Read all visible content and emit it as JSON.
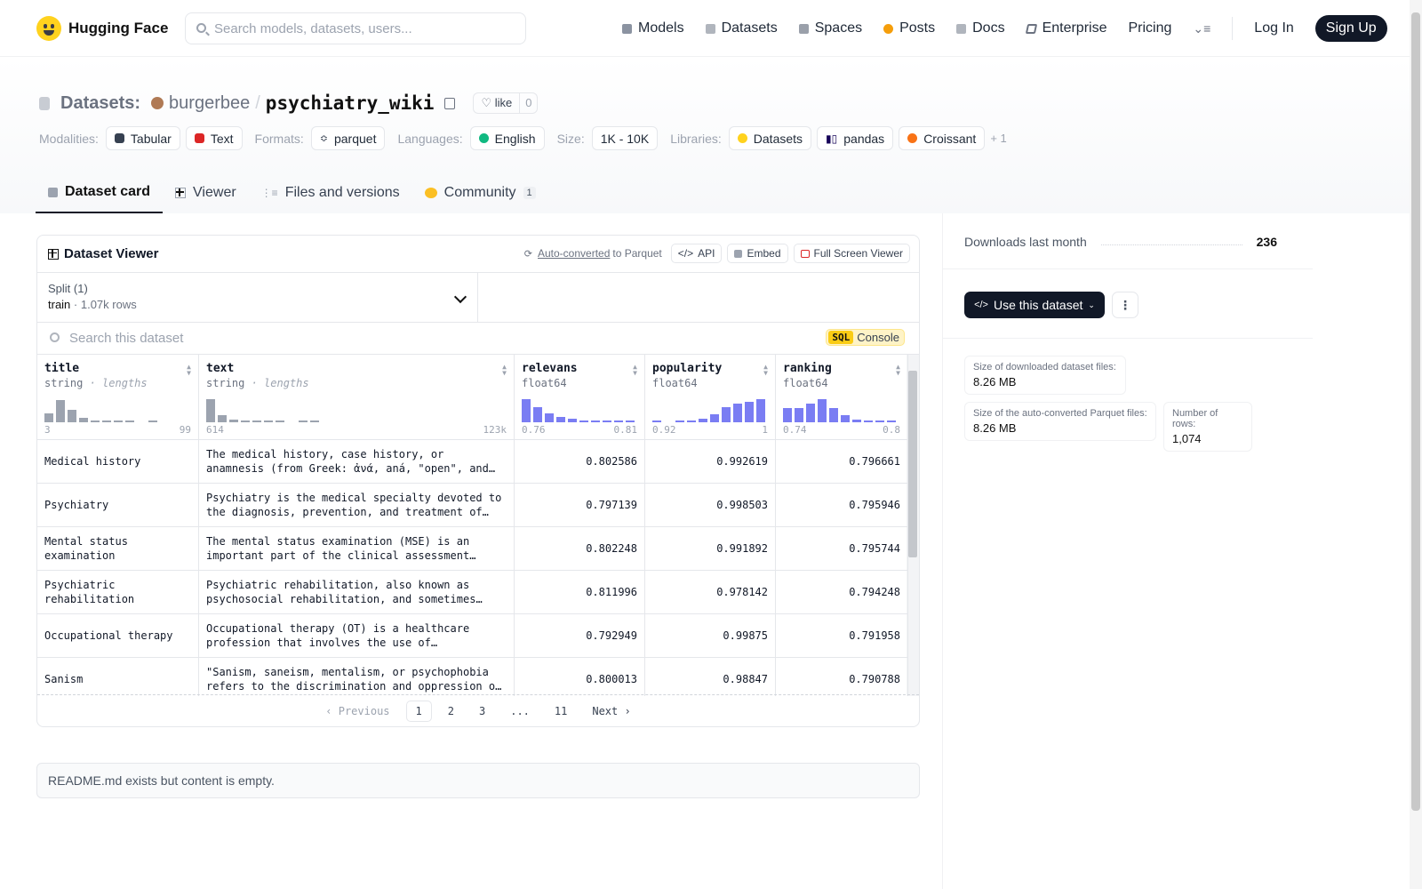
{
  "nav": {
    "brand": "Hugging Face",
    "search_placeholder": "Search models, datasets, users...",
    "links": [
      {
        "label": "Models",
        "icon": "models-icon",
        "color": "#8b93a1"
      },
      {
        "label": "Datasets",
        "icon": "datasets-icon",
        "color": "#b0b5bd"
      },
      {
        "label": "Spaces",
        "icon": "spaces-icon",
        "color": "#9aa0aa"
      },
      {
        "label": "Posts",
        "icon": "posts-icon",
        "color": "#f59e0b"
      },
      {
        "label": "Docs",
        "icon": "docs-icon",
        "color": "#b0b5bd"
      },
      {
        "label": "Enterprise",
        "icon": "enterprise-icon",
        "color": "#6b7280"
      },
      {
        "label": "Pricing",
        "icon": "",
        "color": ""
      }
    ],
    "login": "Log In",
    "signup": "Sign Up"
  },
  "header": {
    "section": "Datasets:",
    "owner": "burgerbee",
    "slash": "/",
    "name": "psychiatry_wiki",
    "like_label": "like",
    "like_count": "0",
    "tags": {
      "modalities_label": "Modalities:",
      "modalities": [
        "Tabular",
        "Text"
      ],
      "formats_label": "Formats:",
      "formats": [
        "parquet"
      ],
      "languages_label": "Languages:",
      "languages": [
        "English"
      ],
      "size_label": "Size:",
      "size": "1K - 10K",
      "libraries_label": "Libraries:",
      "libraries": [
        "Datasets",
        "pandas",
        "Croissant"
      ],
      "more": "+ 1"
    },
    "tabs": [
      {
        "label": "Dataset card",
        "active": true
      },
      {
        "label": "Viewer"
      },
      {
        "label": "Files and versions"
      },
      {
        "label": "Community",
        "badge": "1"
      }
    ]
  },
  "viewer": {
    "title": "Dataset Viewer",
    "auto_converted": "Auto-converted",
    "to_parquet": "to Parquet",
    "api": "API",
    "embed": "Embed",
    "full_screen": "Full Screen Viewer",
    "split_label": "Split (1)",
    "split_name": "train",
    "split_rows": "· 1.07k rows",
    "search_placeholder": "Search this dataset",
    "sql": "SQL",
    "console": "Console",
    "columns": [
      {
        "name": "title",
        "type": "string",
        "sub": "· lengths",
        "min": "3",
        "max": "99",
        "hist": [
          0.4,
          0.95,
          0.55,
          0.2,
          0.08,
          0.05,
          0.04,
          0.04,
          0,
          0.03
        ],
        "kind": "str"
      },
      {
        "name": "text",
        "type": "string",
        "sub": "· lengths",
        "min": "614",
        "max": "123k",
        "hist": [
          1,
          0.3,
          0.12,
          0.06,
          0.04,
          0.03,
          0.03,
          0,
          0.02,
          0.02
        ],
        "kind": "str"
      },
      {
        "name": "relevans",
        "type": "float64",
        "sub": "",
        "min": "0.76",
        "max": "0.81",
        "hist": [
          1,
          0.65,
          0.4,
          0.22,
          0.15,
          0.08,
          0.05,
          0.03,
          0.03,
          0.03
        ],
        "kind": "num"
      },
      {
        "name": "popularity",
        "type": "float64",
        "sub": "",
        "min": "0.92",
        "max": "1",
        "hist": [
          0.03,
          0,
          0.05,
          0.08,
          0.15,
          0.35,
          0.65,
          0.82,
          0.9,
          1
        ],
        "kind": "num"
      },
      {
        "name": "ranking",
        "type": "float64",
        "sub": "",
        "min": "0.74",
        "max": "0.8",
        "hist": [
          0.6,
          0.62,
          0.8,
          1,
          0.6,
          0.3,
          0.12,
          0.05,
          0.03,
          0.03
        ],
        "kind": "num"
      }
    ],
    "rows": [
      {
        "title": "Medical history",
        "text": "The medical history, case history, or anamnesis (from Greek: ἀνά, aná, \"open\", and μνῆσις, mnesis, \"memory\")",
        "relevans": "0.802586",
        "popularity": "0.992619",
        "ranking": "0.796661"
      },
      {
        "title": "Psychiatry",
        "text": "Psychiatry is the medical specialty devoted to the diagnosis, prevention, and treatment of mental disorders",
        "relevans": "0.797139",
        "popularity": "0.998503",
        "ranking": "0.795946"
      },
      {
        "title": "Mental status examination",
        "text": "The mental status examination (MSE) is an important part of the clinical assessment process",
        "relevans": "0.802248",
        "popularity": "0.991892",
        "ranking": "0.795744"
      },
      {
        "title": "Psychiatric rehabilitation",
        "text": "Psychiatric rehabilitation, also known as psychosocial rehabilitation, and sometimes simplified",
        "relevans": "0.811996",
        "popularity": "0.978142",
        "ranking": "0.794248"
      },
      {
        "title": "Occupational therapy",
        "text": "Occupational therapy (OT) is a healthcare profession that involves the use of assessment, intervention",
        "relevans": "0.792949",
        "popularity": "0.99875",
        "ranking": "0.791958"
      },
      {
        "title": "Sanism",
        "text": "\"Sanism, saneism, mentalism, or psychophobia refers to the discrimination and oppression of individuals",
        "relevans": "0.800013",
        "popularity": "0.98847",
        "ranking": "0.790788"
      }
    ],
    "pager": {
      "previous": "Previous",
      "pages": [
        "1",
        "2",
        "3",
        "...",
        "11"
      ],
      "next": "Next"
    }
  },
  "readme": "README.md exists but content is empty.",
  "sidebar": {
    "downloads_label": "Downloads last month",
    "downloads_value": "236",
    "use_dataset": "Use this dataset",
    "download_size_label": "Size of downloaded dataset files:",
    "download_size": "8.26 MB",
    "parquet_size_label": "Size of the auto-converted Parquet files:",
    "parquet_size": "8.26 MB",
    "num_rows_label": "Number of rows:",
    "num_rows": "1,074"
  }
}
